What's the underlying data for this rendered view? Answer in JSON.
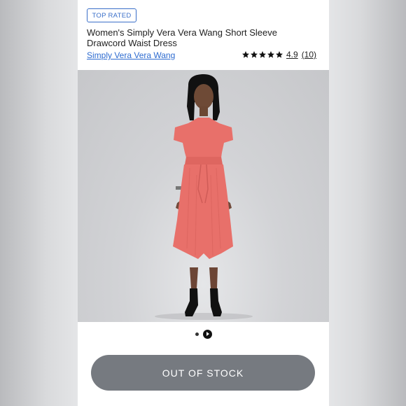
{
  "badge": {
    "label": "TOP RATED"
  },
  "product": {
    "title": "Women's Simply Vera Vera Wang Short Sleeve Drawcord Waist Dress",
    "brand": "Simply Vera Vera Wang",
    "rating": {
      "stars": 5,
      "value": "4.9",
      "count": "(10)",
      "star_color": "#111111"
    },
    "image": {
      "description_icon": "model-photo-icon",
      "dress_color": "#e8706a"
    }
  },
  "carousel": {
    "total_items": 2,
    "active_index": 1,
    "active_icon": "play-icon"
  },
  "stock_button": {
    "label": "OUT OF STOCK",
    "color": "#767a80"
  },
  "colors": {
    "link": "#2d6bd0",
    "badge": "#3a6fc9"
  }
}
